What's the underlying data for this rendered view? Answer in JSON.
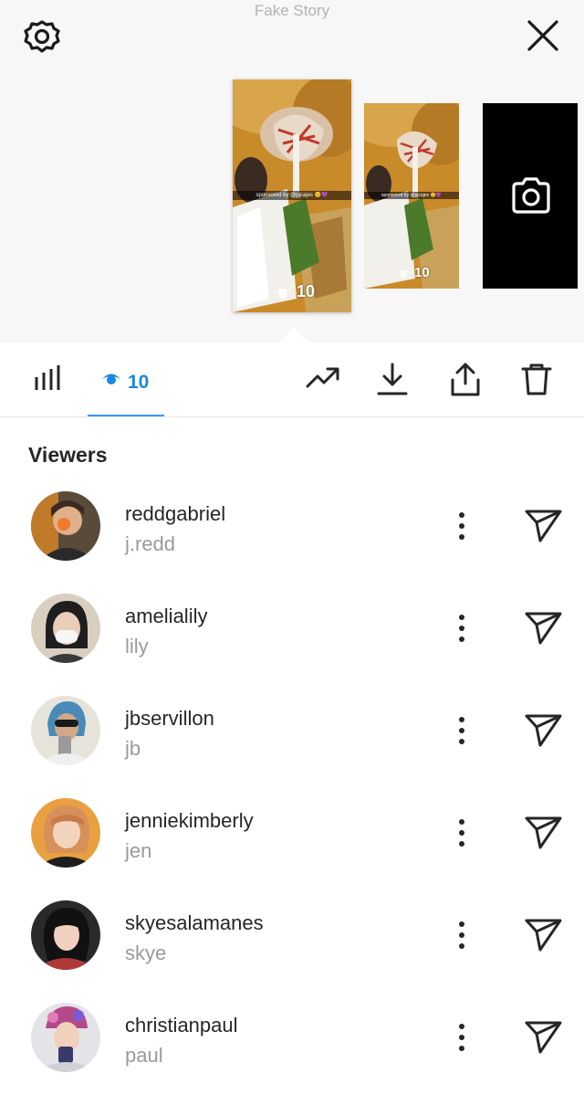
{
  "header": {
    "watermark": "Fake Story",
    "settings_icon": "gear-icon",
    "close_icon": "close-icon"
  },
  "stories": [
    {
      "caption": "sponsored by @pjcajes 😊💜",
      "views": "10",
      "selected": true
    },
    {
      "caption": "sponsored by @pjcajes 😊💜",
      "views": "10",
      "selected": false
    },
    {
      "type": "camera",
      "icon": "camera-icon"
    }
  ],
  "toolbar": {
    "stats_icon": "bar-chart-icon",
    "views_count": "10",
    "actions": [
      "trend-icon",
      "download-icon",
      "share-icon",
      "trash-icon"
    ],
    "accent": "#1a88e0"
  },
  "viewers": {
    "heading": "Viewers",
    "items": [
      {
        "username": "reddgabriel",
        "name": "j.redd"
      },
      {
        "username": "amelialily",
        "name": "lily"
      },
      {
        "username": "jbservillon",
        "name": "jb"
      },
      {
        "username": "jenniekimberly",
        "name": "jen"
      },
      {
        "username": "skyesalamanes",
        "name": "skye"
      },
      {
        "username": "christianpaul",
        "name": "paul"
      }
    ]
  }
}
